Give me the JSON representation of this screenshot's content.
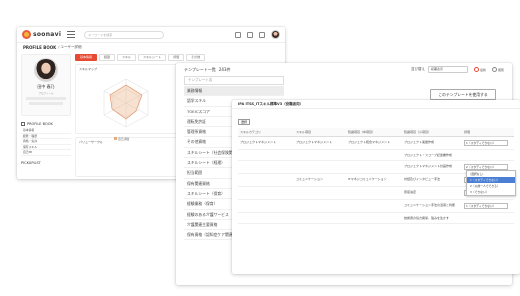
{
  "app": {
    "logo_text": "soonavi",
    "search_placeholder": "キーワードを検索",
    "breadcrumb_title": "PROFILE BOOK",
    "breadcrumb_path": "/ ユーザー詳細"
  },
  "profile": {
    "name": "田中 春乃",
    "sub": "プロフィール",
    "book_title": "PROFILE BOOK",
    "book_items": [
      "基本情報",
      "経歴・職歴",
      "資格・免許",
      "保有スキル",
      "自己PR"
    ],
    "pickup_title": "PICKUPLIST"
  },
  "tabs": [
    "基本情報",
    "経歴",
    "スキル",
    "スキルシート",
    "評価",
    "その他"
  ],
  "panels": {
    "skill_title": "スキルマップ",
    "right_title": "",
    "bottom_title": "バリューサークル",
    "legend": "自己評価"
  },
  "template_list": {
    "title": "テンプレート一覧",
    "count": "243件",
    "sort_label": "並び替え",
    "sort_value": "初期表示",
    "radio_labels": [
      "最新",
      "閲覧"
    ],
    "search_placeholder": "テンプレート名",
    "items": [
      "業務情報",
      "語学スキル",
      "TOEICスコア",
      "運転免許証",
      "管理系資格",
      "その他資格",
      "スキルシート（社会保険関係）",
      "スキルシート（経理）",
      "担当範囲",
      "保有関連資格",
      "スキルシート（保育）",
      "経験業務（保育）",
      "経験のある介護サービス",
      "介護関連主要資格",
      "保有資格（認知症ケア関連）"
    ],
    "use_button": "このテンプレートを使用する"
  },
  "detail": {
    "title": "IPA ITSS_ITスキル標準V3（役職者向）",
    "box_label": "選択",
    "headers": [
      "スキルカテゴリ",
      "スキル項目",
      "知識項目（中項目）",
      "知識項目（小項目）",
      "評価"
    ],
    "rows": [
      [
        "プロジェクトマネジメント",
        "プロジェクトマネジメント",
        "プロジェクト統合マネジメント",
        "プロジェクト憲章作成",
        "1（スタディできない）"
      ],
      [
        "",
        "",
        "",
        "プロジェクト・スコープ記述書作成",
        ""
      ],
      [
        "",
        "",
        "",
        "プロジェクトマネジメント計画作成",
        "2（スタディできない）"
      ],
      [
        "",
        "コミュニケーション",
        "ITマネジコミュニケーション",
        "対話及びインタビュー手法",
        "1（スタディできない）"
      ],
      [
        "",
        "",
        "",
        "意思決定",
        "1（スタディできない）"
      ],
      [
        "",
        "",
        "",
        "コミュニケーション手法の活用と判断",
        "1（スタディできない）"
      ],
      [
        "",
        "",
        "",
        "技術者の協力関係、強みを生かす",
        ""
      ]
    ],
    "dropdown": [
      "(選択なし)",
      "1（スタディできない）",
      "2（以前一人でできる）",
      "3（できない）"
    ]
  }
}
